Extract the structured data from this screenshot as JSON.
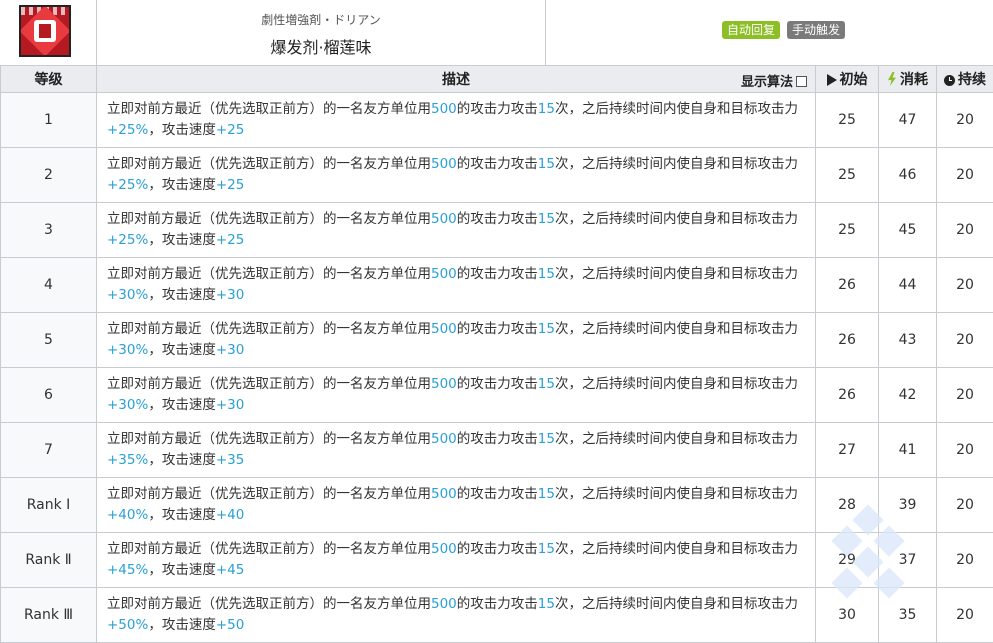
{
  "skill": {
    "name_jp": "劇性増強剤・ドリアン",
    "name": "爆发剂·榴莲味",
    "tags": [
      "自动回复",
      "手动触发"
    ]
  },
  "table": {
    "headers": {
      "level": "等级",
      "description": "描述",
      "show_formula": "显示算法",
      "initial": "初始",
      "cost": "消耗",
      "duration": "持续"
    },
    "rows": [
      {
        "level": "1",
        "p1": "立即对前方最近（优先选取正前方）的一名友方单位用",
        "v1": "500",
        "p2": "的攻击力攻击",
        "v2": "15",
        "p3": "次，之后持续时间内使自身和目标攻击力",
        "v3": "+25%",
        "p4": "，攻击速度",
        "v4": "+25",
        "initial": "25",
        "cost": "47",
        "duration": "20"
      },
      {
        "level": "2",
        "p1": "立即对前方最近（优先选取正前方）的一名友方单位用",
        "v1": "500",
        "p2": "的攻击力攻击",
        "v2": "15",
        "p3": "次，之后持续时间内使自身和目标攻击力",
        "v3": "+25%",
        "p4": "，攻击速度",
        "v4": "+25",
        "initial": "25",
        "cost": "46",
        "duration": "20"
      },
      {
        "level": "3",
        "p1": "立即对前方最近（优先选取正前方）的一名友方单位用",
        "v1": "500",
        "p2": "的攻击力攻击",
        "v2": "15",
        "p3": "次，之后持续时间内使自身和目标攻击力",
        "v3": "+25%",
        "p4": "，攻击速度",
        "v4": "+25",
        "initial": "25",
        "cost": "45",
        "duration": "20"
      },
      {
        "level": "4",
        "p1": "立即对前方最近（优先选取正前方）的一名友方单位用",
        "v1": "500",
        "p2": "的攻击力攻击",
        "v2": "15",
        "p3": "次，之后持续时间内使自身和目标攻击力",
        "v3": "+30%",
        "p4": "，攻击速度",
        "v4": "+30",
        "initial": "26",
        "cost": "44",
        "duration": "20"
      },
      {
        "level": "5",
        "p1": "立即对前方最近（优先选取正前方）的一名友方单位用",
        "v1": "500",
        "p2": "的攻击力攻击",
        "v2": "15",
        "p3": "次，之后持续时间内使自身和目标攻击力",
        "v3": "+30%",
        "p4": "，攻击速度",
        "v4": "+30",
        "initial": "26",
        "cost": "43",
        "duration": "20"
      },
      {
        "level": "6",
        "p1": "立即对前方最近（优先选取正前方）的一名友方单位用",
        "v1": "500",
        "p2": "的攻击力攻击",
        "v2": "15",
        "p3": "次，之后持续时间内使自身和目标攻击力",
        "v3": "+30%",
        "p4": "，攻击速度",
        "v4": "+30",
        "initial": "26",
        "cost": "42",
        "duration": "20"
      },
      {
        "level": "7",
        "p1": "立即对前方最近（优先选取正前方）的一名友方单位用",
        "v1": "500",
        "p2": "的攻击力攻击",
        "v2": "15",
        "p3": "次，之后持续时间内使自身和目标攻击力",
        "v3": "+35%",
        "p4": "，攻击速度",
        "v4": "+35",
        "initial": "27",
        "cost": "41",
        "duration": "20"
      },
      {
        "level": "Rank Ⅰ",
        "p1": "立即对前方最近（优先选取正前方）的一名友方单位用",
        "v1": "500",
        "p2": "的攻击力攻击",
        "v2": "15",
        "p3": "次，之后持续时间内使自身和目标攻击力",
        "v3": "+40%",
        "p4": "，攻击速度",
        "v4": "+40",
        "initial": "28",
        "cost": "39",
        "duration": "20"
      },
      {
        "level": "Rank Ⅱ",
        "p1": "立即对前方最近（优先选取正前方）的一名友方单位用",
        "v1": "500",
        "p2": "的攻击力攻击",
        "v2": "15",
        "p3": "次，之后持续时间内使自身和目标攻击力",
        "v3": "+45%",
        "p4": "，攻击速度",
        "v4": "+45",
        "initial": "29",
        "cost": "37",
        "duration": "20"
      },
      {
        "level": "Rank Ⅲ",
        "p1": "立即对前方最近（优先选取正前方）的一名友方单位用",
        "v1": "500",
        "p2": "的攻击力攻击",
        "v2": "15",
        "p3": "次，之后持续时间内使自身和目标攻击力",
        "v3": "+50%",
        "p4": "，攻击速度",
        "v4": "+50",
        "initial": "30",
        "cost": "35",
        "duration": "20"
      }
    ]
  },
  "colors": {
    "highlight": "#2aa0d6",
    "tag_auto": "#8cbf26",
    "tag_manual": "#7a7a7a",
    "header_bg": "#eaecf0"
  },
  "icons": {
    "initial": "play-icon",
    "cost": "lightning-icon",
    "duration": "clock-icon"
  }
}
